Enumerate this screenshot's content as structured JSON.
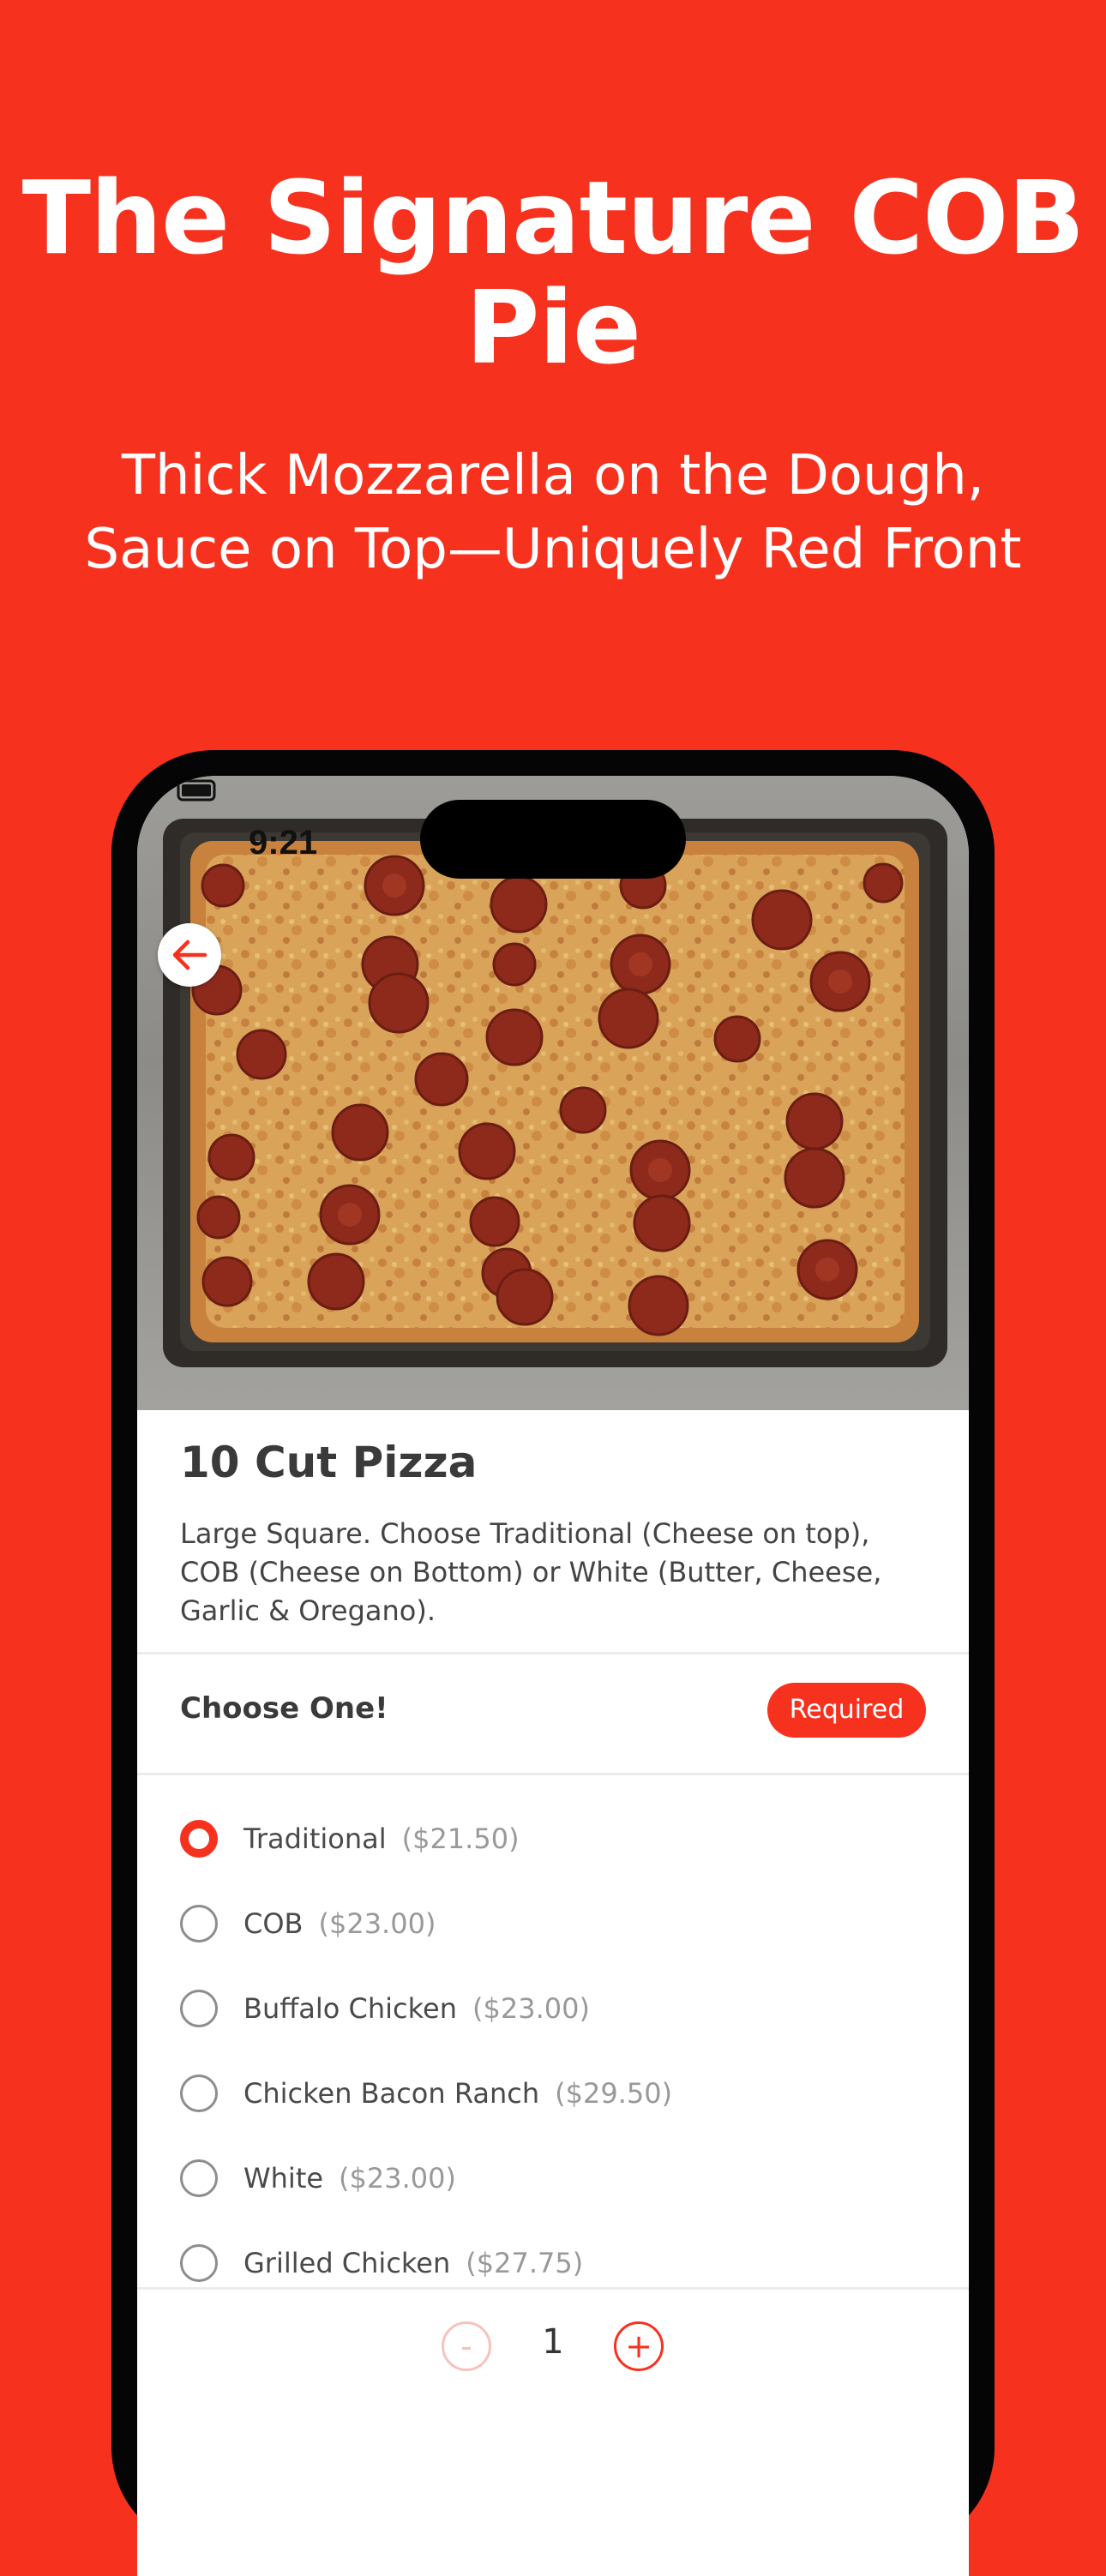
{
  "promo": {
    "headline_line1": "The Signature COB",
    "headline_line2": "Pie",
    "subhead_line1": "Thick Mozzarella on the Dough,",
    "subhead_line2": "Sauce on Top—Uniquely Red Front"
  },
  "status_bar": {
    "time": "9:21"
  },
  "item": {
    "title": "10 Cut Pizza",
    "description": "Large Square. Choose Traditional (Cheese on top), COB (Cheese on Bottom) or White (Butter, Cheese, Garlic & Oregano)."
  },
  "choice_group": {
    "label": "Choose One!",
    "badge": "Required",
    "options": [
      {
        "name": "Traditional",
        "price": "($21.50)",
        "selected": true
      },
      {
        "name": "COB",
        "price": "($23.00)",
        "selected": false
      },
      {
        "name": "Buffalo Chicken",
        "price": "($23.00)",
        "selected": false
      },
      {
        "name": "Chicken Bacon Ranch",
        "price": "($29.50)",
        "selected": false
      },
      {
        "name": "White",
        "price": "($23.00)",
        "selected": false
      },
      {
        "name": "Grilled Chicken",
        "price": "($27.75)",
        "selected": false
      }
    ]
  },
  "quantity": {
    "minus_label": "-",
    "value": "1",
    "plus_label": "+"
  },
  "colors": {
    "brand_red": "#F6321F",
    "text_dark": "#3a3a3a",
    "text_muted": "#999999"
  },
  "icons": {
    "back": "arrow-left-icon",
    "radio_selected": "radio-selected-icon",
    "radio_unselected": "radio-unselected-icon"
  }
}
